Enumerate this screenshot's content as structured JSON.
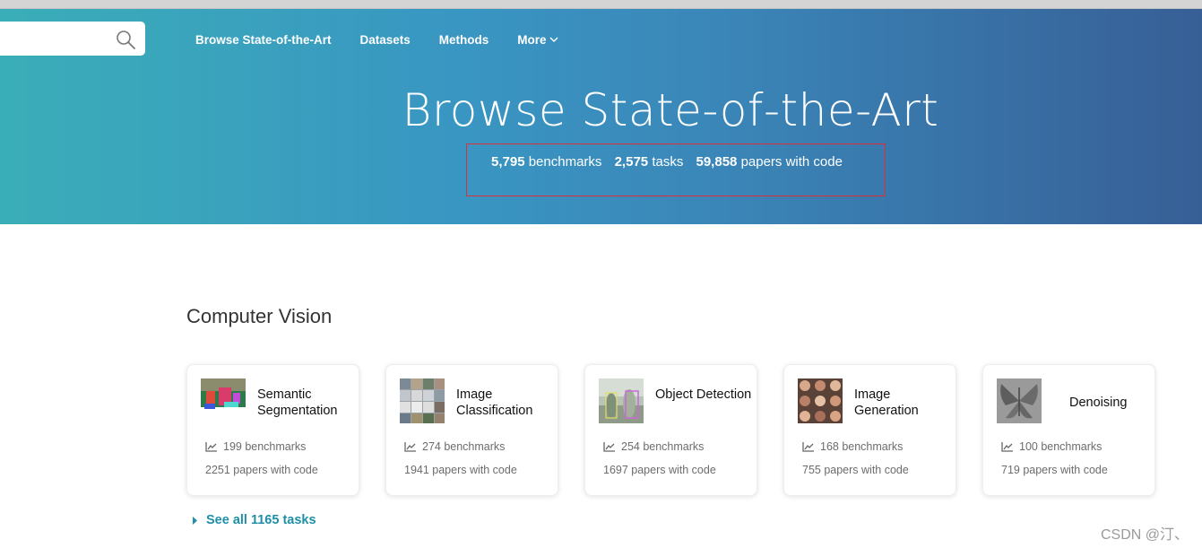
{
  "nav": {
    "items": [
      "Browse State-of-the-Art",
      "Datasets",
      "Methods",
      "More"
    ]
  },
  "hero": {
    "title": "Browse State-of-the-Art",
    "stats": [
      {
        "value": "5,795",
        "label": "benchmarks"
      },
      {
        "value": "2,575",
        "label": "tasks"
      },
      {
        "value": "59,858",
        "label": "papers with code"
      }
    ]
  },
  "section": {
    "title": "Computer Vision",
    "cards": [
      {
        "title": "Semantic Segmentation",
        "benchmarks": "199 benchmarks",
        "papers": "2251 papers with code"
      },
      {
        "title": "Image Classification",
        "benchmarks": "274 benchmarks",
        "papers": "1941 papers with code"
      },
      {
        "title": "Object Detection",
        "benchmarks": "254 benchmarks",
        "papers": "1697 papers with code"
      },
      {
        "title": "Image Generation",
        "benchmarks": "168 benchmarks",
        "papers": "755 papers with code"
      },
      {
        "title": "Denoising",
        "benchmarks": "100 benchmarks",
        "papers": "719 papers with code"
      }
    ],
    "see_all": "See all 1165 tasks"
  },
  "watermark": "CSDN @汀、",
  "colors": {
    "hero_start": "#3aaeb8",
    "hero_end": "#375f96",
    "link": "#1f8fa6",
    "highlight": "#d9303a"
  }
}
